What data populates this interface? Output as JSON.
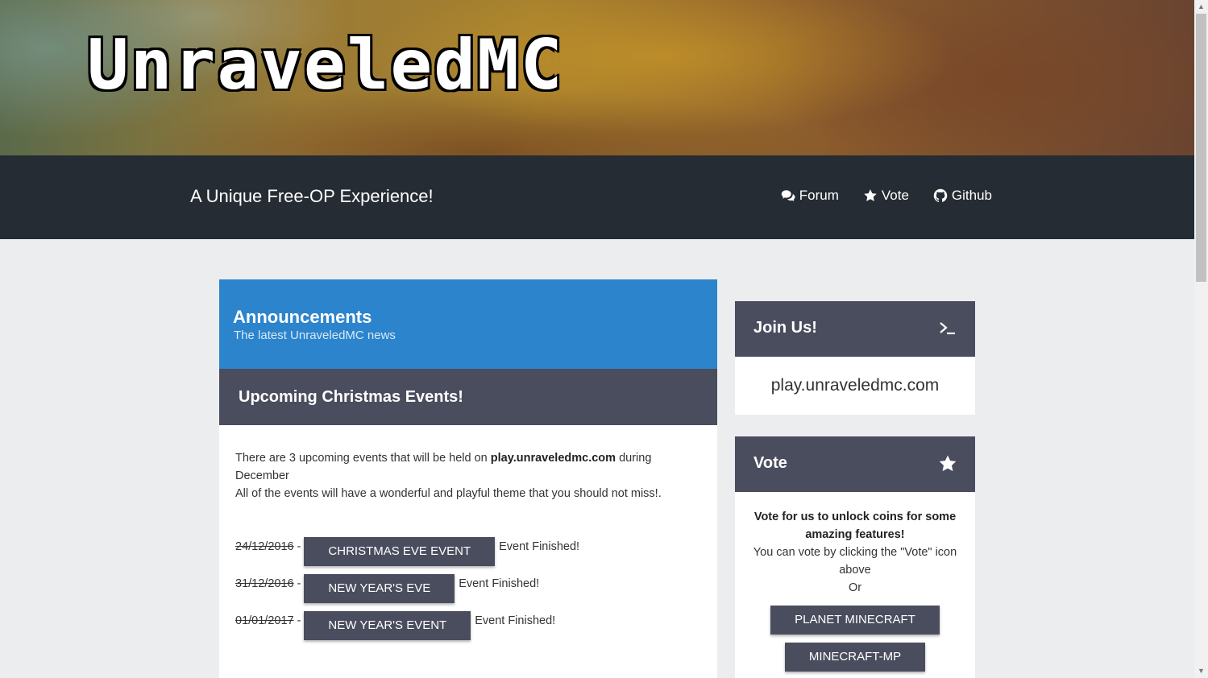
{
  "header": {
    "logo_text": "UnraveledMC"
  },
  "navbar": {
    "tagline": "A Unique Free-OP Experience!",
    "links": [
      {
        "label": "Forum",
        "icon": "comments-icon"
      },
      {
        "label": "Vote",
        "icon": "star-icon"
      },
      {
        "label": "Github",
        "icon": "github-icon"
      }
    ]
  },
  "announcements": {
    "title": "Announcements",
    "subtitle": "The latest UnraveledMC news",
    "post": {
      "title": "Upcoming Christmas Events!",
      "text_before": "There are 3 upcoming events that will be held on ",
      "text_bold": "play.unraveledmc.com",
      "text_after": " during December",
      "text_line2": "All of the events will have a wonderful and playful theme that you should not miss!.",
      "events": [
        {
          "date": "24/12/2016",
          "sep": "-",
          "name": "Christmas Eve Event",
          "status": "Event Finished!"
        },
        {
          "date": "31/12/2016",
          "sep": "-",
          "name": "New Year's Eve",
          "status": "Event Finished!"
        },
        {
          "date": "01/01/2017",
          "sep": "-",
          "name": "New Year's Event",
          "status": "Event Finished!"
        }
      ]
    }
  },
  "sidebar": {
    "join": {
      "title": "Join Us!",
      "icon": "terminal-icon",
      "address": "play.unraveledmc.com"
    },
    "vote": {
      "title": "Vote",
      "icon": "star-icon",
      "line1": "Vote for us to unlock coins for some amazing features!",
      "line2": "You can vote by clicking the \"Vote\" icon above",
      "line3": "Or",
      "buttons": [
        "PLANET MINECRAFT",
        "MINECRAFT-MP"
      ]
    }
  },
  "colors": {
    "navbar_bg": "#252c34",
    "accent_blue": "#2c84cc",
    "panel_dark": "#4a4d5e",
    "page_bg": "#ecedee"
  }
}
